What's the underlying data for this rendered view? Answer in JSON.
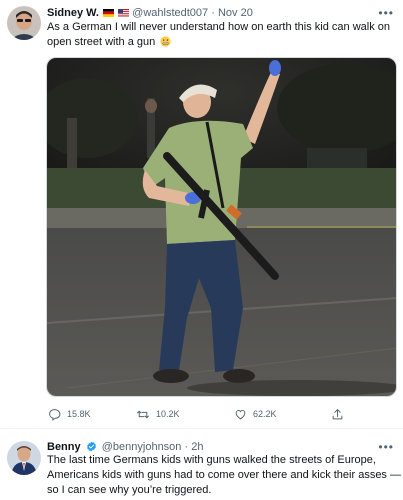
{
  "tweet_main": {
    "display_name": "Sidney W.",
    "handle": "@wahlstedt007",
    "separator": "·",
    "timestamp": "Nov 20",
    "text_line1": "As a German I will never understand how on earth this kid can walk on",
    "text_line2": "open street with a gun",
    "emoji_icon": "grimacing-face-icon",
    "actions": {
      "reply_count": "15.8K",
      "retweet_count": "10.2K",
      "like_count": "62.2K"
    }
  },
  "tweet_reply": {
    "display_name": "Benny",
    "handle": "@bennyjohnson",
    "separator": "·",
    "timestamp": "2h",
    "text_line1": "The last time Germans kids with guns walked the streets of Europe,",
    "text_line2": "Americans kids with guns had to come over there and kick their asses —",
    "text_line3": "so I can see why you’re triggered."
  },
  "colors": {
    "text_primary": "#0f1419",
    "text_secondary": "#536471",
    "verified": "#1d9bf0",
    "border": "#cfd9de"
  }
}
